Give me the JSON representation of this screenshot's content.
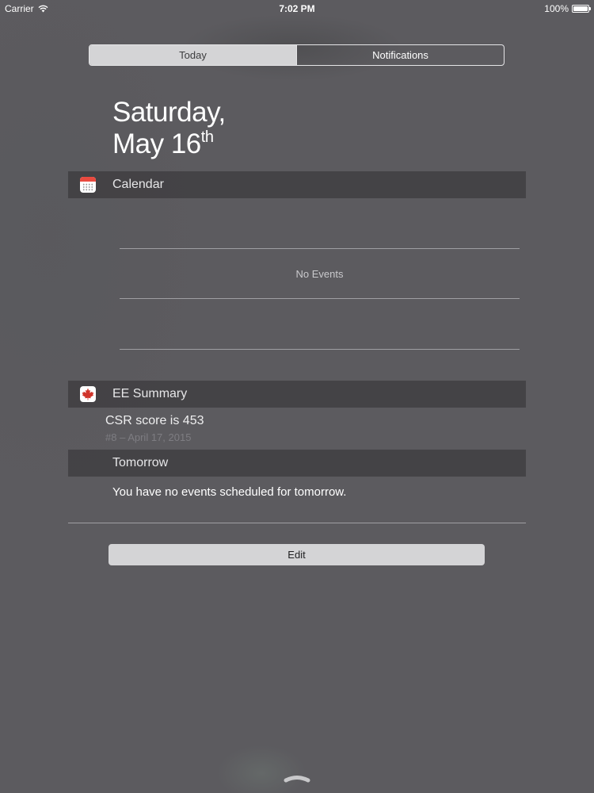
{
  "status_bar": {
    "carrier": "Carrier",
    "time": "7:02 PM",
    "battery": "100%"
  },
  "segmented_control": {
    "tabs": [
      {
        "label": "Today",
        "selected": true
      },
      {
        "label": "Notifications",
        "selected": false
      }
    ]
  },
  "date": {
    "weekday": "Saturday,",
    "month_day": "May 16",
    "suffix": "th"
  },
  "calendar_widget": {
    "title": "Calendar",
    "icon": "calendar-icon",
    "empty_text": "No Events"
  },
  "ee_summary_widget": {
    "title": "EE Summary",
    "icon": "maple-leaf-icon",
    "score_text": "CSR score is 453",
    "subtitle": "#8 – April 17, 2015"
  },
  "tomorrow_widget": {
    "title": "Tomorrow",
    "message": "You have no events scheduled for tomorrow."
  },
  "edit_button": {
    "label": "Edit"
  },
  "colors": {
    "background": "#5c5b5f",
    "section_header": "#3c3b3e",
    "segment_active": "#d4d4d6",
    "calendar_red": "#e94a3f",
    "maple_red": "#d0342a"
  }
}
